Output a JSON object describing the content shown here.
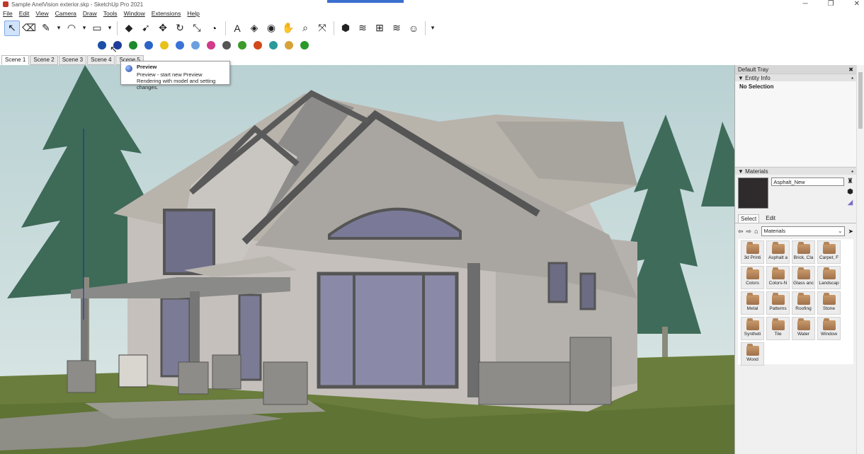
{
  "window": {
    "title": "Sample AnelVision exterior.skp - SketchUp Pro 2021",
    "controls": [
      "─",
      "❐",
      "✕"
    ]
  },
  "menu": [
    "File",
    "Edit",
    "View",
    "Camera",
    "Draw",
    "Tools",
    "Window",
    "Extensions",
    "Help"
  ],
  "toolbar_main": [
    {
      "name": "select-icon",
      "glyph": "↖"
    },
    {
      "name": "eraser-icon",
      "glyph": "⌫"
    },
    {
      "name": "pencil-icon",
      "glyph": "✎"
    },
    {
      "name": "dropdown-icon",
      "glyph": "▾"
    },
    {
      "name": "arc-icon",
      "glyph": "◠"
    },
    {
      "name": "dropdown-icon",
      "glyph": "▾"
    },
    {
      "name": "rectangle-icon",
      "glyph": "▭"
    },
    {
      "name": "dropdown-icon",
      "glyph": "▾"
    },
    {
      "name": "push-pull-icon",
      "glyph": "◆"
    },
    {
      "name": "follow-me-icon",
      "glyph": "➹"
    },
    {
      "name": "move-icon",
      "glyph": "✥"
    },
    {
      "name": "rotate-icon",
      "glyph": "↻"
    },
    {
      "name": "scale-icon",
      "glyph": "⤡"
    },
    {
      "name": "tape-measure-icon",
      "glyph": "◔"
    },
    {
      "name": "text-icon",
      "glyph": "A"
    },
    {
      "name": "paint-bucket-icon",
      "glyph": "◈"
    },
    {
      "name": "orbit-icon",
      "glyph": "◉"
    },
    {
      "name": "pan-icon",
      "glyph": "✋"
    },
    {
      "name": "zoom-icon",
      "glyph": "⌕"
    },
    {
      "name": "zoom-extents-icon",
      "glyph": "⤧"
    },
    {
      "name": "warehouse-icon",
      "glyph": "⬢"
    },
    {
      "name": "extension-warehouse-icon",
      "glyph": "≋"
    },
    {
      "name": "layout-icon",
      "glyph": "⊞"
    },
    {
      "name": "sandbox-icon",
      "glyph": "≋"
    },
    {
      "name": "account-icon",
      "glyph": "☺"
    },
    {
      "name": "dropdown-icon",
      "glyph": "▾"
    }
  ],
  "toolbar_render": [
    {
      "name": "render-settings-icon",
      "color": "#1a4fa8"
    },
    {
      "name": "preview-icon",
      "color": "#1f3c9c"
    },
    {
      "name": "render-icon",
      "color": "#1a8a2a"
    },
    {
      "name": "material-editor-icon",
      "color": "#2a64c8"
    },
    {
      "name": "light-icon",
      "color": "#e8c21a"
    },
    {
      "name": "point-light-icon",
      "color": "#3a73d8"
    },
    {
      "name": "spot-light-icon",
      "color": "#6aa0e0"
    },
    {
      "name": "color-wheel-icon",
      "color": "#d23a8a"
    },
    {
      "name": "chart-icon",
      "color": "#555555"
    },
    {
      "name": "leaf-icon",
      "color": "#3a9a2a"
    },
    {
      "name": "film-icon",
      "color": "#d24a1a"
    },
    {
      "name": "image-icon",
      "color": "#2a9a9a"
    },
    {
      "name": "folder-open-icon",
      "color": "#d8a23a"
    },
    {
      "name": "help-icon",
      "color": "#2a9a2a"
    }
  ],
  "scenes": [
    "Scene 1",
    "Scene 2",
    "Scene 3",
    "Scene 4",
    "Scene 5"
  ],
  "tooltip": {
    "title": "Preview",
    "text": "Preview - start new Preview Rendering with model and setting changes."
  },
  "tray": {
    "title": "Default Tray",
    "entity_panel": {
      "title": "Entity Info",
      "status": "No Selection"
    },
    "materials_panel": {
      "title": "Materials",
      "current": "Asphalt_New",
      "swatch_color": "#2f2b2c",
      "tabs": [
        "Select",
        "Edit"
      ],
      "library": "Materials",
      "items": [
        "3d Printi",
        "Asphalt a",
        "Brick, Cla",
        "Carpet, F",
        "Colors",
        "Colors-N",
        "Glass anc",
        "Landscap",
        "Metal",
        "Patterns",
        "Roofing",
        "Stone",
        "Syntheti",
        "Tile",
        "Water",
        "Window",
        "Wood"
      ]
    }
  }
}
